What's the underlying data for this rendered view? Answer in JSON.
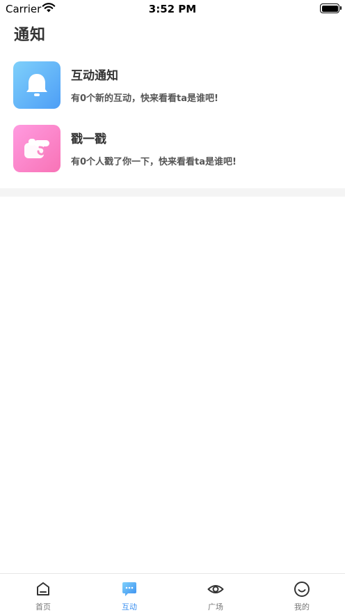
{
  "status_bar": {
    "carrier": "Carrier",
    "time": "3:52 PM"
  },
  "page": {
    "title": "通知"
  },
  "notices": [
    {
      "title": "互动通知",
      "desc": "有0个新的互动，快来看看ta是谁吧!",
      "icon": "bell-icon",
      "color": "#5aaaf8"
    },
    {
      "title": "戳一戳",
      "desc": "有0个人戳了你一下，快来看看ta是谁吧!",
      "icon": "poke-hand-icon",
      "color": "#f97fc3"
    }
  ],
  "tabs": [
    {
      "label": "首页",
      "icon": "home-icon",
      "active": false
    },
    {
      "label": "互动",
      "icon": "chat-bubble-icon",
      "active": true
    },
    {
      "label": "广场",
      "icon": "eye-icon",
      "active": false
    },
    {
      "label": "我的",
      "icon": "smile-icon",
      "active": false
    }
  ],
  "colors": {
    "accent": "#3a8ff0",
    "tab_inactive": "#777777"
  }
}
